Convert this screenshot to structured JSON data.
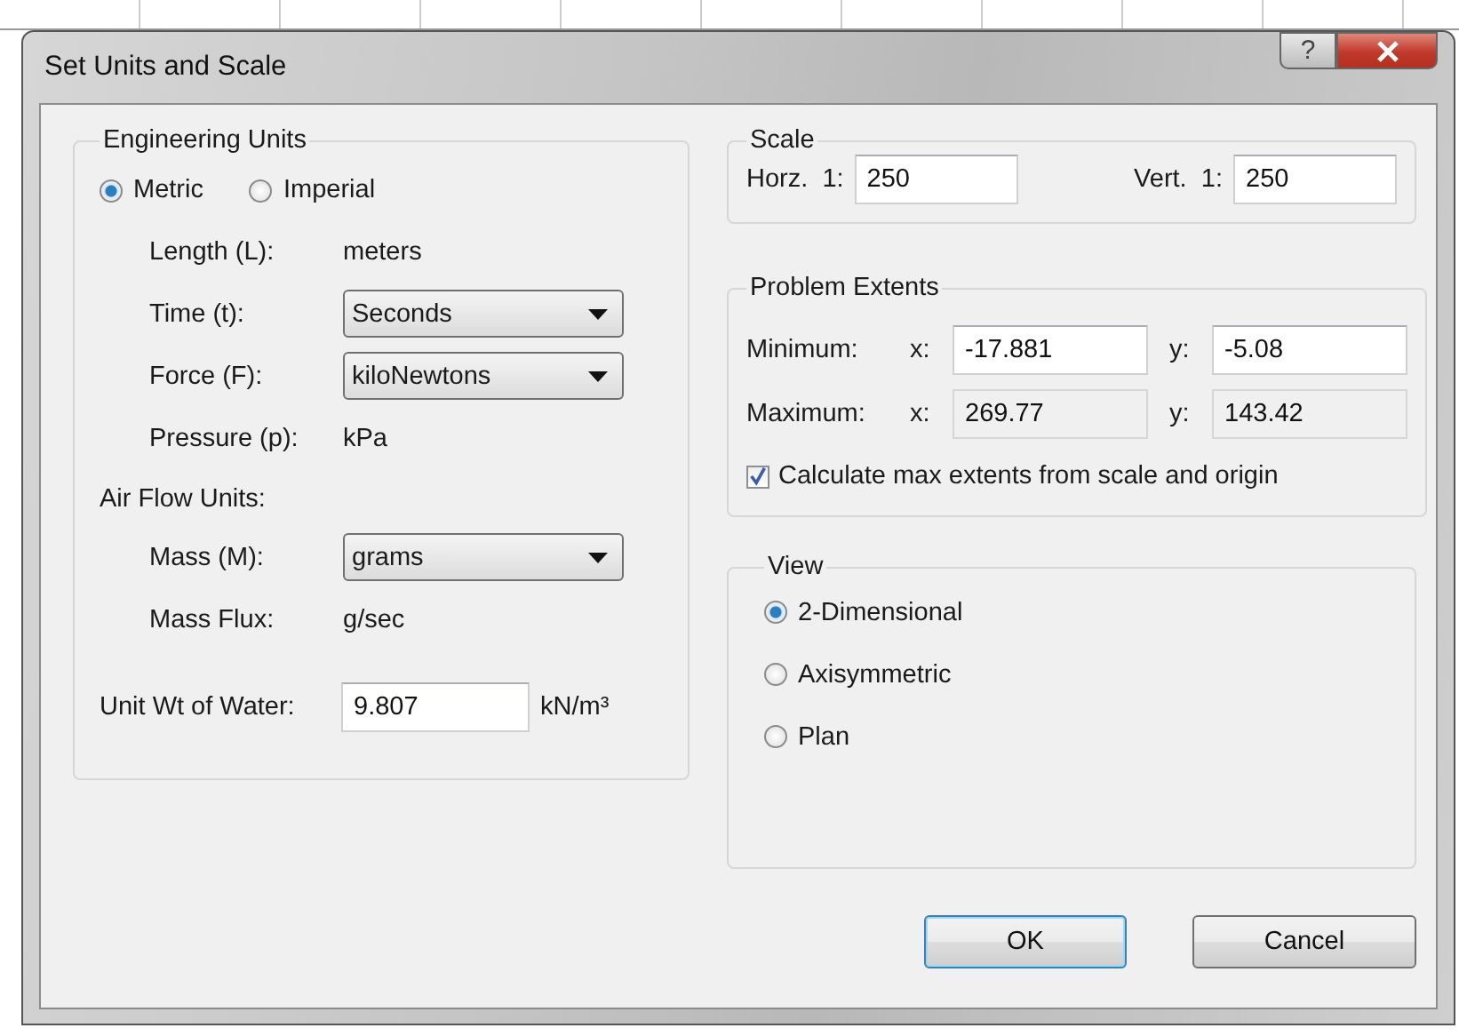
{
  "window": {
    "title": "Set Units and Scale",
    "help_button": "?"
  },
  "engineering_units": {
    "title": "Engineering Units",
    "unit_system": [
      {
        "label": "Metric",
        "selected": true
      },
      {
        "label": "Imperial",
        "selected": false
      }
    ],
    "rows": [
      {
        "kind": "text",
        "label": "Length (L):",
        "value": "meters"
      },
      {
        "kind": "dropdown",
        "label": "Time (t):",
        "value": "Seconds"
      },
      {
        "kind": "dropdown",
        "label": "Force (F):",
        "value": "kiloNewtons"
      },
      {
        "kind": "text",
        "label": "Pressure (p):",
        "value": "kPa"
      }
    ],
    "air_flow": {
      "title": "Air Flow Units:",
      "rows": [
        {
          "kind": "dropdown",
          "label": "Mass (M):",
          "value": "grams"
        },
        {
          "kind": "text",
          "label": "Mass Flux:",
          "value": "g/sec"
        }
      ]
    },
    "unit_weight": {
      "label": "Unit Wt of Water:",
      "value": "9.807",
      "unit": "kN/m³"
    }
  },
  "scale": {
    "title": "Scale",
    "fields": [
      {
        "label": "Horz.  1:",
        "value": "250"
      },
      {
        "label": "Vert.  1:",
        "value": "250"
      }
    ]
  },
  "problem_extents": {
    "title": "Problem Extents",
    "rows": [
      {
        "label": "Minimum:",
        "x_label": "x:",
        "x_value": "-17.881",
        "y_label": "y:",
        "y_value": "-5.08",
        "disabled": false
      },
      {
        "label": "Maximum:",
        "x_label": "x:",
        "x_value": "269.77",
        "y_label": "y:",
        "y_value": "143.42",
        "disabled": true
      }
    ],
    "checkbox": {
      "label": "Calculate max extents from scale and origin",
      "checked": true
    }
  },
  "view": {
    "title": "View",
    "options": [
      {
        "label": "2-Dimensional",
        "selected": true
      },
      {
        "label": "Axisymmetric",
        "selected": false
      },
      {
        "label": "Plan",
        "selected": false
      }
    ]
  },
  "buttons": [
    {
      "label": "OK",
      "default": true
    },
    {
      "label": "Cancel",
      "default": false
    }
  ]
}
